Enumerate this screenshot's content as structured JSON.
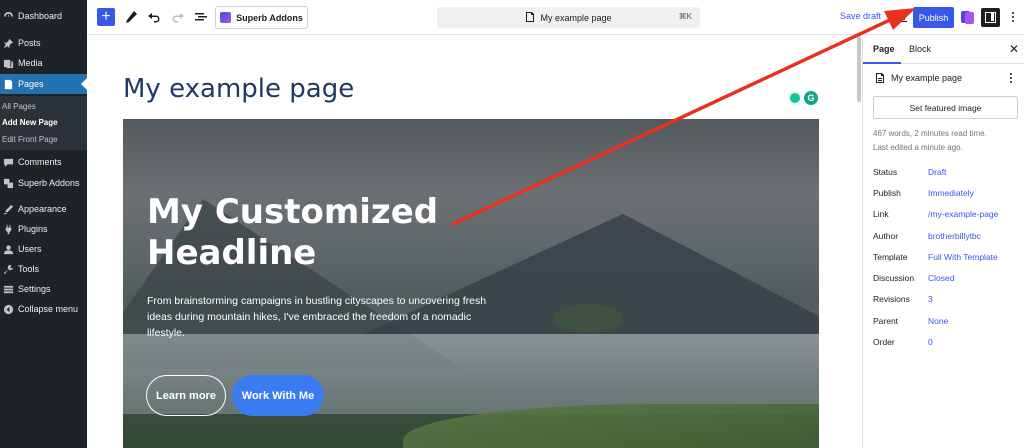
{
  "sidebar": {
    "items": [
      {
        "label": "Dashboard",
        "icon": "dashboard-icon"
      },
      {
        "label": "Posts",
        "icon": "pin-icon"
      },
      {
        "label": "Media",
        "icon": "media-icon"
      },
      {
        "label": "Pages",
        "icon": "pages-icon"
      },
      {
        "label": "Comments",
        "icon": "comments-icon"
      },
      {
        "label": "Superb Addons",
        "icon": "superb-addons-icon"
      },
      {
        "label": "Appearance",
        "icon": "appearance-icon"
      },
      {
        "label": "Plugins",
        "icon": "plugins-icon"
      },
      {
        "label": "Users",
        "icon": "users-icon"
      },
      {
        "label": "Tools",
        "icon": "tools-icon"
      },
      {
        "label": "Settings",
        "icon": "settings-icon"
      },
      {
        "label": "Collapse menu",
        "icon": "collapse-icon"
      }
    ],
    "submenu": [
      "All Pages",
      "Add New Page",
      "Edit Front Page"
    ]
  },
  "toolbar": {
    "superb_label": "Superb Addons",
    "doc_title": "My example page",
    "shortcut": "⌘K",
    "save_draft": "Save draft",
    "publish": "Publish"
  },
  "canvas": {
    "page_title": "My example page",
    "hero": {
      "headline": "My Customized Headline",
      "body": "From brainstorming campaigns in bustling cityscapes to uncovering fresh ideas during mountain hikes, I've embraced the freedom of a nomadic lifestyle.",
      "button_primary": "Learn more",
      "button_secondary": "Work With Me"
    },
    "grammarly_letter": "G"
  },
  "settings": {
    "tabs": [
      "Page",
      "Block"
    ],
    "post_title": "My example page",
    "featured_image": "Set featured image",
    "stats": "467 words, 2 minutes read time.",
    "last_edited": "Last edited a minute ago.",
    "properties": [
      {
        "label": "Status",
        "value": "Draft"
      },
      {
        "label": "Publish",
        "value": "Immediately"
      },
      {
        "label": "Link",
        "value": "/my-example-page"
      },
      {
        "label": "Author",
        "value": "brotherbillytbc"
      },
      {
        "label": "Template",
        "value": "Full With Template"
      },
      {
        "label": "Discussion",
        "value": "Closed"
      },
      {
        "label": "Revisions",
        "value": "3"
      },
      {
        "label": "Parent",
        "value": "None"
      },
      {
        "label": "Order",
        "value": "0"
      }
    ]
  },
  "colors": {
    "admin_bg": "#1d2327",
    "active_menu": "#2271b1",
    "accent": "#3858e9",
    "annotation_arrow": "#e8321f",
    "hero_button": "#3a7cf0"
  }
}
